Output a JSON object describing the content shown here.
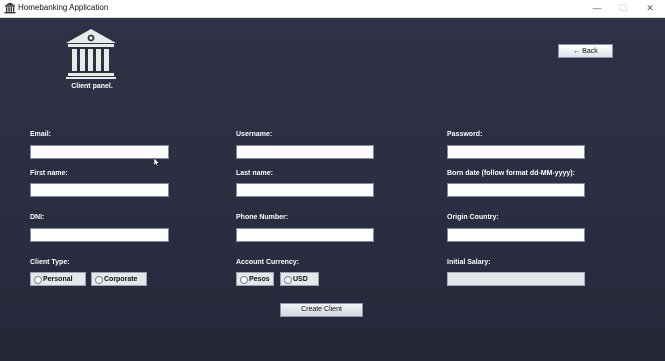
{
  "window": {
    "title": "Homebanking Application",
    "minimize_glyph": "—",
    "maximize_glyph": "☐",
    "close_glyph": "✕",
    "app_icon": "bank-icon"
  },
  "header": {
    "logo_icon": "bank-building-icon",
    "caption": "Client panel."
  },
  "back_button": "← Back",
  "form": {
    "email": {
      "label": "Email:",
      "value": ""
    },
    "username": {
      "label": "Username:",
      "value": ""
    },
    "password": {
      "label": "Password:",
      "value": ""
    },
    "first_name": {
      "label": "First name:",
      "value": ""
    },
    "last_name": {
      "label": "Last name:",
      "value": ""
    },
    "born_date": {
      "label": "Born date (follow format dd-MM-yyyy):",
      "value": ""
    },
    "dni": {
      "label": "DNI:",
      "value": ""
    },
    "phone": {
      "label": "Phone Number:",
      "value": ""
    },
    "origin_country": {
      "label": "Origin Country:",
      "value": ""
    },
    "client_type": {
      "label": "Client Type:",
      "options": [
        "Personal",
        "Corporate"
      ]
    },
    "account_currency": {
      "label": "Account Currency:",
      "options": [
        "Pesos",
        "USD"
      ]
    },
    "initial_salary": {
      "label": "Initial Salary:",
      "value": ""
    }
  },
  "create_button": "Create Client",
  "colors": {
    "background": "#2b2d41",
    "label": "#ffffff",
    "input": "#ffffff",
    "disabled_input": "#e4e6ea"
  }
}
